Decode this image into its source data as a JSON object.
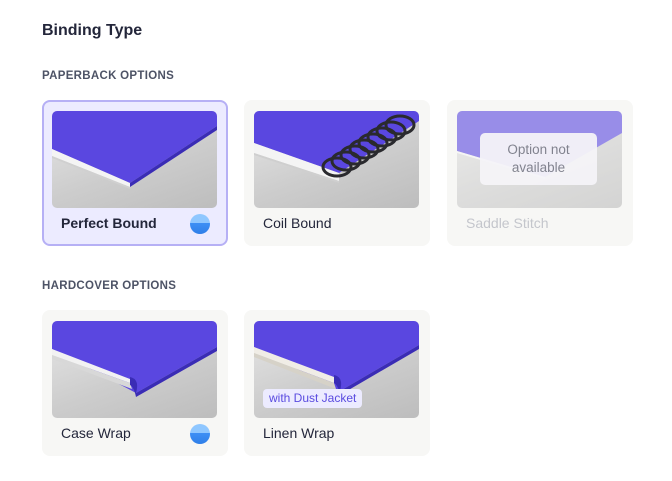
{
  "page": {
    "title": "Binding Type"
  },
  "paperback": {
    "label": "PAPERBACK OPTIONS",
    "cards": [
      {
        "label": "Perfect Bound",
        "selected": true,
        "available": true,
        "has_badge_dot": true
      },
      {
        "label": "Coil Bound",
        "selected": false,
        "available": true,
        "has_badge_dot": false
      },
      {
        "label": "Saddle Stitch",
        "selected": false,
        "available": false,
        "has_badge_dot": false,
        "overlay": "Option not available"
      }
    ]
  },
  "hardcover": {
    "label": "HARDCOVER OPTIONS",
    "cards": [
      {
        "label": "Case Wrap",
        "selected": false,
        "available": true,
        "has_badge_dot": true
      },
      {
        "label": "Linen Wrap",
        "selected": false,
        "available": true,
        "has_badge_dot": false,
        "tag": "with Dust Jacket"
      }
    ]
  },
  "colors": {
    "accent": "#5b4ce6",
    "cover": "#5a47e0",
    "selected_bg": "#ecebff",
    "selected_border": "#b6b0f5",
    "card_bg": "#f7f7f5",
    "badge_dot": "#3d8ff5"
  },
  "icons": {
    "selected_dot": "blue-circle-icon"
  }
}
